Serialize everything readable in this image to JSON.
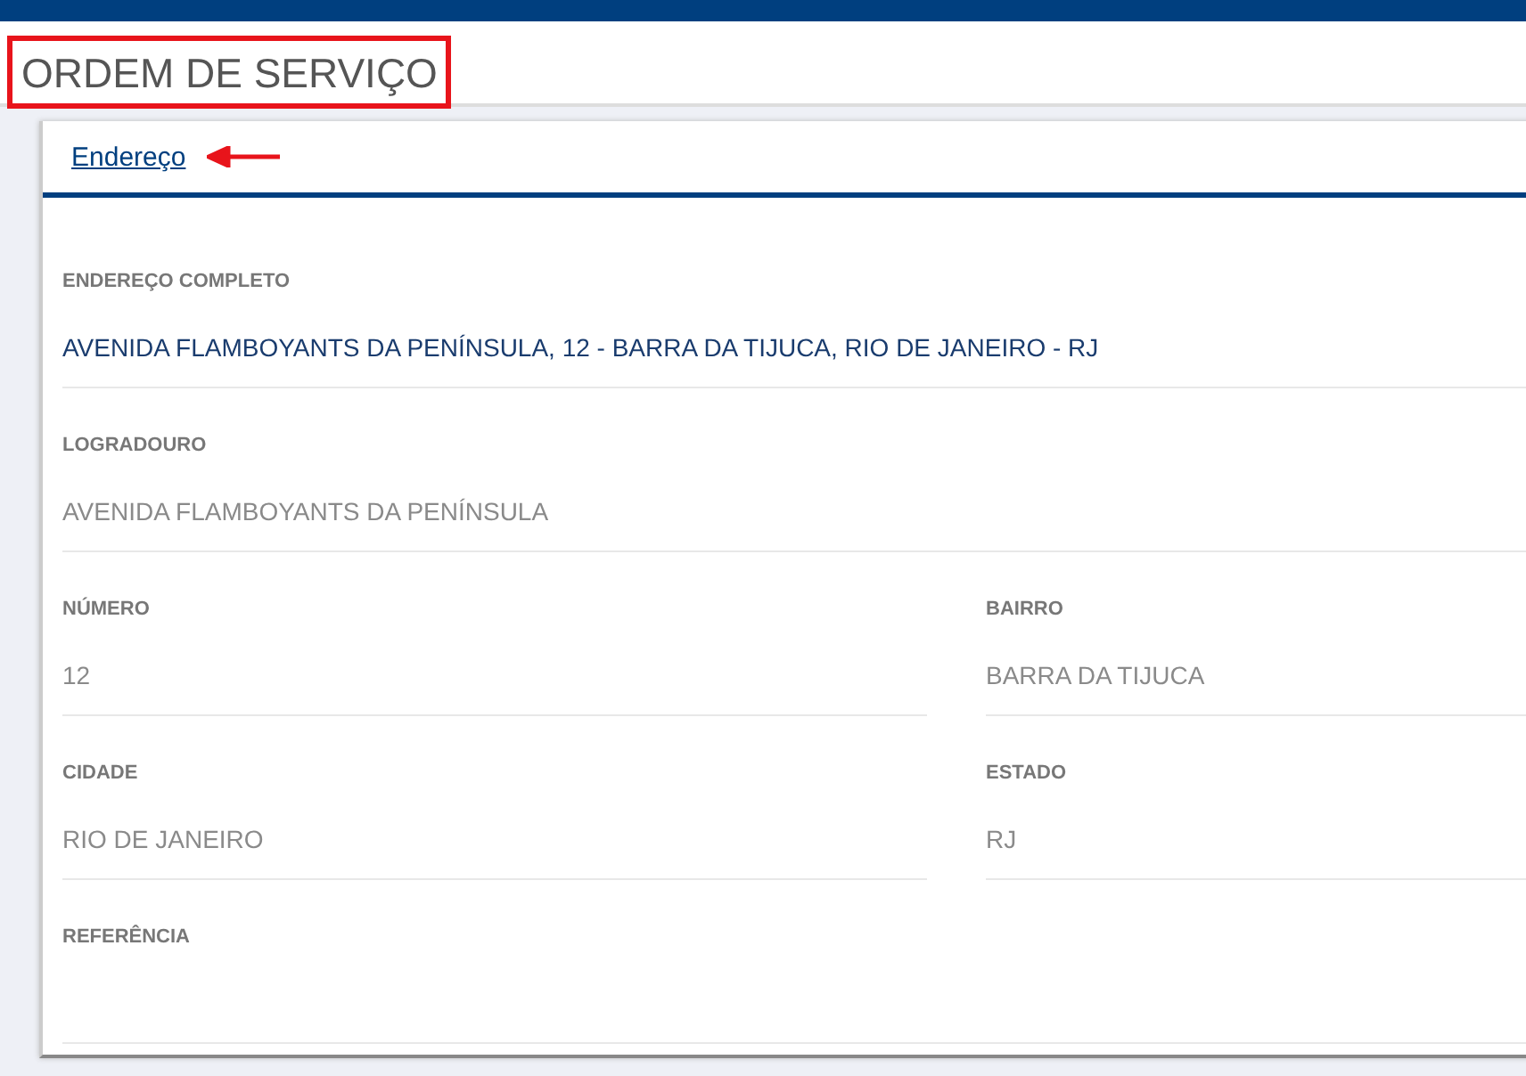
{
  "page_title": "ORDEM DE SERVIÇO",
  "tabs": [
    {
      "label": "Endereço",
      "selected": true
    }
  ],
  "fields": [
    {
      "label": "ENDEREÇO COMPLETO",
      "value": "AVENIDA FLAMBOYANTS DA PENÍNSULA, 12 - BARRA DA TIJUCA, RIO DE JANEIRO - RJ",
      "kind": "full",
      "disabled": false
    },
    {
      "label": "LOGRADOURO",
      "value": "AVENIDA FLAMBOYANTS DA PENÍNSULA",
      "kind": "full",
      "disabled": true
    },
    {
      "label": "NÚMERO",
      "value": "12",
      "kind": "half",
      "disabled": true
    },
    {
      "label": "BAIRRO",
      "value": "BARRA DA TIJUCA",
      "kind": "half",
      "disabled": true
    },
    {
      "label": "CIDADE",
      "value": "RIO DE JANEIRO",
      "kind": "half",
      "disabled": true
    },
    {
      "label": "ESTADO",
      "value": "RJ",
      "kind": "half",
      "disabled": true
    },
    {
      "label": "REFERÊNCIA",
      "kind": "full"
    }
  ]
}
